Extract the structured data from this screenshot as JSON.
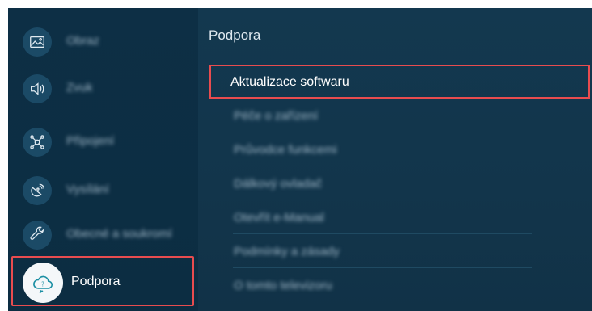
{
  "sidebar": {
    "items": [
      {
        "label": "Obraz",
        "icon": "picture-icon"
      },
      {
        "label": "Zvuk",
        "icon": "sound-icon"
      },
      {
        "label": "Připojení",
        "icon": "network-icon"
      },
      {
        "label": "Vysílání",
        "icon": "broadcasting-icon"
      },
      {
        "label": "Obecné a soukromí",
        "icon": "wrench-icon"
      },
      {
        "label": "Podpora",
        "icon": "support-cloud-icon"
      }
    ]
  },
  "panel": {
    "title": "Podpora",
    "items": [
      {
        "label": "Aktualizace softwaru"
      },
      {
        "label": "Péče o zařízení"
      },
      {
        "label": "Průvodce funkcemi"
      },
      {
        "label": "Dálkový ovladač"
      },
      {
        "label": "Otevřít e-Manual"
      },
      {
        "label": "Podmínky a zásady"
      },
      {
        "label": "O tomto televizoru"
      }
    ]
  }
}
